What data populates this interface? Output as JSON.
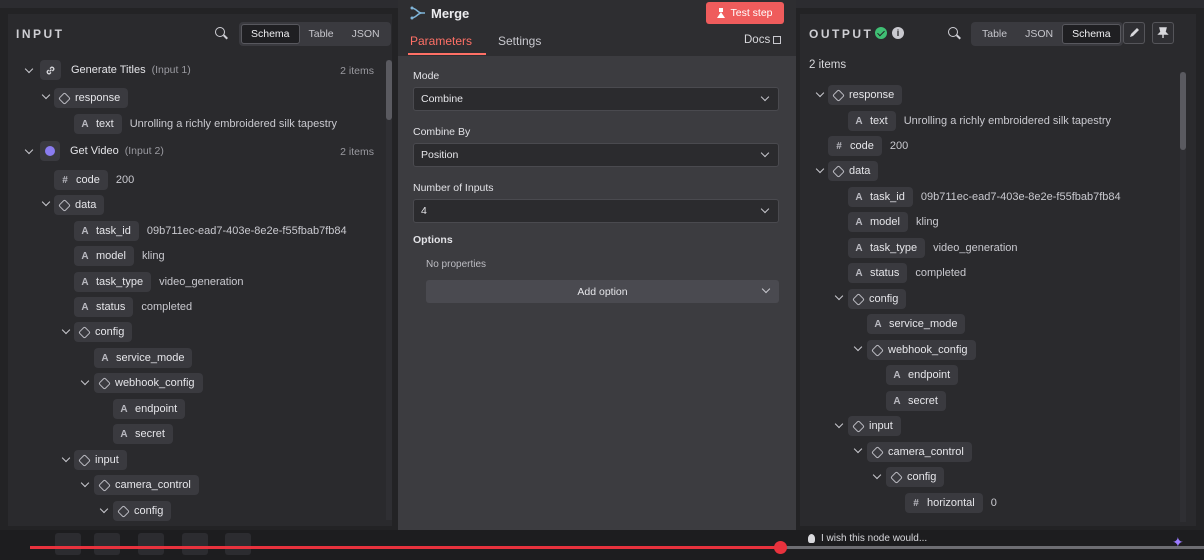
{
  "input_panel": {
    "title": "INPUT",
    "view_tabs": [
      "Schema",
      "Table",
      "JSON"
    ],
    "active_tab": "Schema",
    "nodes": [
      {
        "name": "Generate Titles",
        "sub": "(Input 1)",
        "count": "2 items"
      },
      {
        "name": "Get Video",
        "sub": "(Input 2)",
        "count": "2 items"
      }
    ],
    "fields": {
      "response": "response",
      "text": "text",
      "text_value": "Unrolling a richly embroidered silk tapestry",
      "code": "code",
      "code_value": "200",
      "data": "data",
      "task_id": "task_id",
      "task_id_value": "09b711ec-ead7-403e-8e2e-f55fbab7fb84",
      "model": "model",
      "model_value": "kling",
      "task_type": "task_type",
      "task_type_value": "video_generation",
      "status": "status",
      "status_value": "completed",
      "config": "config",
      "service_mode": "service_mode",
      "webhook_config": "webhook_config",
      "endpoint": "endpoint",
      "secret": "secret",
      "input": "input",
      "camera_control": "camera_control",
      "config2": "config"
    }
  },
  "center_panel": {
    "title": "Merge",
    "test_step_label": "Test step",
    "tabs": [
      "Parameters",
      "Settings"
    ],
    "active_tab": "Parameters",
    "docs_label": "Docs",
    "mode_label": "Mode",
    "mode_value": "Combine",
    "combine_by_label": "Combine By",
    "combine_by_value": "Position",
    "num_inputs_label": "Number of Inputs",
    "num_inputs_value": "4",
    "options_label": "Options",
    "no_properties": "No properties",
    "add_option_label": "Add option"
  },
  "output_panel": {
    "title": "OUTPUT",
    "view_tabs": [
      "Table",
      "JSON",
      "Schema"
    ],
    "active_tab": "Schema",
    "items_count": "2 items",
    "fields": {
      "response": "response",
      "text": "text",
      "text_value": "Unrolling a richly embroidered silk tapestry",
      "code": "code",
      "code_value": "200",
      "data": "data",
      "task_id": "task_id",
      "task_id_value": "09b711ec-ead7-403e-8e2e-f55fbab7fb84",
      "model": "model",
      "model_value": "kling",
      "task_type": "task_type",
      "task_type_value": "video_generation",
      "status": "status",
      "status_value": "completed",
      "config": "config",
      "service_mode": "service_mode",
      "webhook_config": "webhook_config",
      "endpoint": "endpoint",
      "secret": "secret",
      "input": "input",
      "camera_control": "camera_control",
      "config2": "config",
      "horizontal": "horizontal",
      "horizontal_value": "0"
    }
  },
  "bottom": {
    "feedback_text": "I wish this node would...",
    "progress_fraction": 0.64
  },
  "colors": {
    "accent": "#ff7066",
    "test_button": "#ef5c5c",
    "success": "#3fbf74",
    "progress": "#e8323d"
  }
}
